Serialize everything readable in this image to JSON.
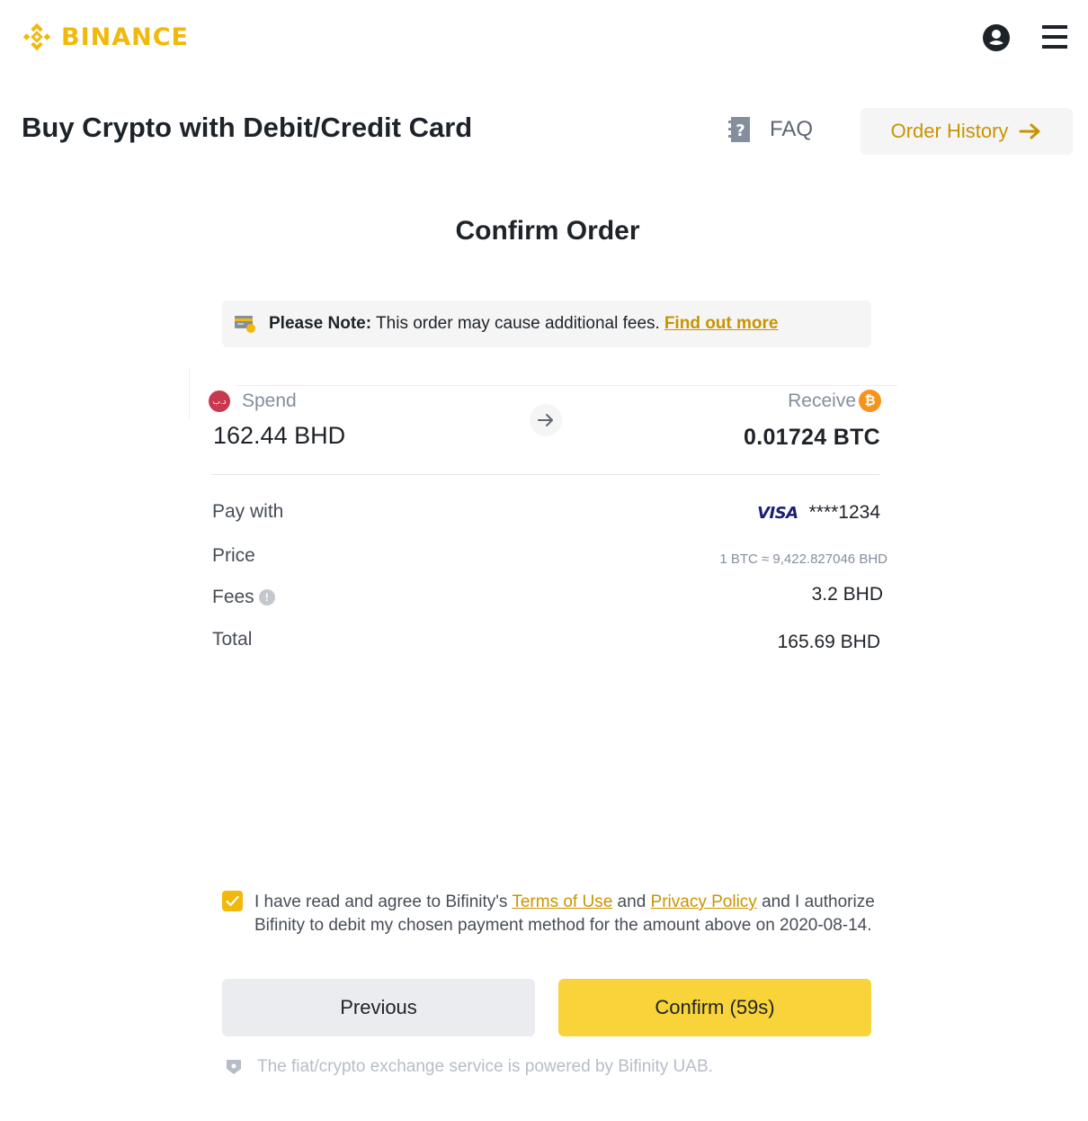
{
  "header": {
    "brand": "BINANCE",
    "brand_color": "#F0B90B",
    "icons": {
      "account": "user-circle-icon",
      "menu": "hamburger-menu-icon"
    }
  },
  "page": {
    "title": "Buy Crypto with Debit/Credit Card",
    "faq_label": "FAQ",
    "order_history_label": "Order History"
  },
  "order": {
    "title": "Confirm Order",
    "note": {
      "bold": "Please Note:",
      "text": "This order may cause additional fees.",
      "link": "Find out more"
    },
    "spend": {
      "label": "Spend",
      "value": "162.44 BHD",
      "currency_icon_text": "د.ب"
    },
    "receive": {
      "label": "Receive",
      "value": "0.01724 BTC",
      "currency_icon_text": "₿"
    },
    "details": {
      "pay_with": {
        "label": "Pay with",
        "card_brand": "VISA",
        "card_number": "****1234"
      },
      "price": {
        "label": "Price",
        "value": "1 BTC ≈ 9,422.827046 BHD"
      },
      "fees": {
        "label": "Fees",
        "value": "3.2 BHD",
        "info_icon": "!"
      },
      "total": {
        "label": "Total",
        "value": "165.69 BHD"
      }
    }
  },
  "agreement": {
    "checked": true,
    "text_1": "I have read and agree to Bifinity's ",
    "terms_link": "Terms of Use",
    "text_2": " and ",
    "privacy_link": "Privacy Policy",
    "text_3": " and I authorize Bifinity to debit my chosen payment method for the amount above on 2020-08-14."
  },
  "actions": {
    "previous_label": "Previous",
    "confirm_label": "Confirm (59s)"
  },
  "footer": {
    "powered_by": "The fiat/crypto exchange service is powered by Bifinity UAB."
  },
  "colors": {
    "accent": "#F0B90B",
    "link": "#C99400",
    "confirm_button": "#F8D33A",
    "secondary_button": "#EAECEF"
  }
}
